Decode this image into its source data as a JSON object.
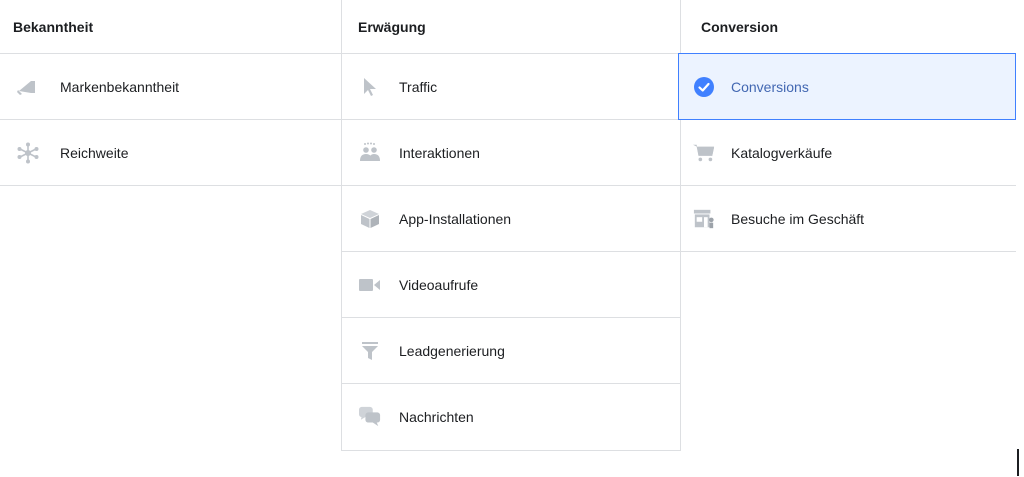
{
  "columns": [
    {
      "title": "Bekanntheit",
      "items": [
        {
          "label": "Markenbekanntheit",
          "icon": "megaphone-icon"
        },
        {
          "label": "Reichweite",
          "icon": "reach-network-icon"
        }
      ]
    },
    {
      "title": "Erwägung",
      "items": [
        {
          "label": "Traffic",
          "icon": "cursor-arrow-icon"
        },
        {
          "label": "Interaktionen",
          "icon": "people-icon"
        },
        {
          "label": "App-Installationen",
          "icon": "box-icon"
        },
        {
          "label": "Videoaufrufe",
          "icon": "video-camera-icon"
        },
        {
          "label": "Leadgenerierung",
          "icon": "funnel-icon"
        },
        {
          "label": "Nachrichten",
          "icon": "chat-bubbles-icon"
        }
      ]
    },
    {
      "title": "Conversion",
      "items": [
        {
          "label": "Conversions",
          "icon": "check-circle-icon",
          "selected": true
        },
        {
          "label": "Katalogverkäufe",
          "icon": "shopping-cart-icon"
        },
        {
          "label": "Besuche im Geschäft",
          "icon": "store-icon"
        }
      ]
    }
  ],
  "colors": {
    "icon_gray": "#bec3c9",
    "selected_blue": "#4080ff",
    "selected_bg": "#ecf3ff",
    "border": "#dddfe2"
  }
}
